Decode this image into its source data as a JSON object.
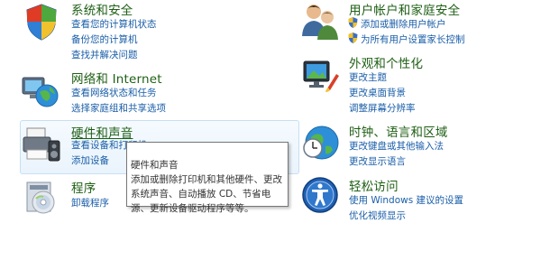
{
  "categories": {
    "system_security": {
      "title": "系统和安全",
      "links": [
        "查看您的计算机状态",
        "备份您的计算机",
        "查找并解决问题"
      ],
      "icon": "shield-flag-icon"
    },
    "network": {
      "title": "网络和 Internet",
      "links": [
        "查看网络状态和任务",
        "选择家庭组和共享选项"
      ],
      "icon": "network-globe-icon"
    },
    "hardware": {
      "title": "硬件和声音",
      "links": [
        "查看设备和打印机",
        "添加设备"
      ],
      "icon": "printer-speaker-icon"
    },
    "programs": {
      "title": "程序",
      "links": [
        "卸载程序"
      ],
      "icon": "programs-disc-icon"
    },
    "users": {
      "title": "用户帐户和家庭安全",
      "links": [
        "添加或删除用户帐户",
        "为所有用户设置家长控制"
      ],
      "icon": "users-icon"
    },
    "appearance": {
      "title": "外观和个性化",
      "links": [
        "更改主题",
        "更改桌面背景",
        "调整屏幕分辨率"
      ],
      "icon": "monitor-paint-icon"
    },
    "clock": {
      "title": "时钟、语言和区域",
      "links": [
        "更改键盘或其他输入法",
        "更改显示语言"
      ],
      "icon": "clock-globe-icon"
    },
    "ease": {
      "title": "轻松访问",
      "links": [
        "使用 Windows 建议的设置",
        "优化视频显示"
      ],
      "icon": "ease-of-access-icon"
    }
  },
  "tooltip": {
    "title": "硬件和声音",
    "body": "添加或删除打印机和其他硬件、更改系统声音、自动播放 CD、节省电源、更新设备驱动程序等等。"
  }
}
